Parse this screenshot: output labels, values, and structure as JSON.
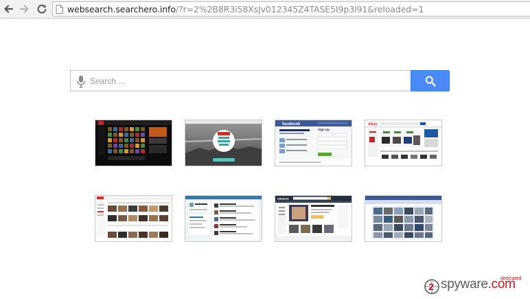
{
  "browser": {
    "url_host": "websearch.searchero.info",
    "url_rest": "/?r=2%2B8R3i58XsJv012345Z4TASE5I9p3I91&reloaded=1",
    "icons": {
      "back": "back-arrow-icon",
      "forward": "forward-arrow-icon",
      "reload": "reload-icon",
      "page": "page-icon"
    }
  },
  "search": {
    "placeholder": "Search ...",
    "value": "",
    "mic_icon": "microphone-icon",
    "button_icon": "magnifier-icon",
    "button_color": "#4a8af4"
  },
  "thumbnails": [
    {
      "id": "game-site"
    },
    {
      "id": "youtube-watch-and-be"
    },
    {
      "id": "facebook-signup",
      "label": "facebook",
      "header_text": "Sign Up"
    },
    {
      "id": "ebay-shop",
      "label": "ebay"
    },
    {
      "id": "video-gallery-site"
    },
    {
      "id": "twitter-feed"
    },
    {
      "id": "amazon-shop",
      "label": "amazon"
    },
    {
      "id": "photo-grid-site"
    }
  ],
  "watermark": {
    "number": "2",
    "brand": "spyware",
    "tld": ".com",
    "tag": "dedicated"
  },
  "colors": {
    "search_button": "#4a8af4",
    "facebook": "#3b5998",
    "watermark_red": "#c4161c"
  }
}
